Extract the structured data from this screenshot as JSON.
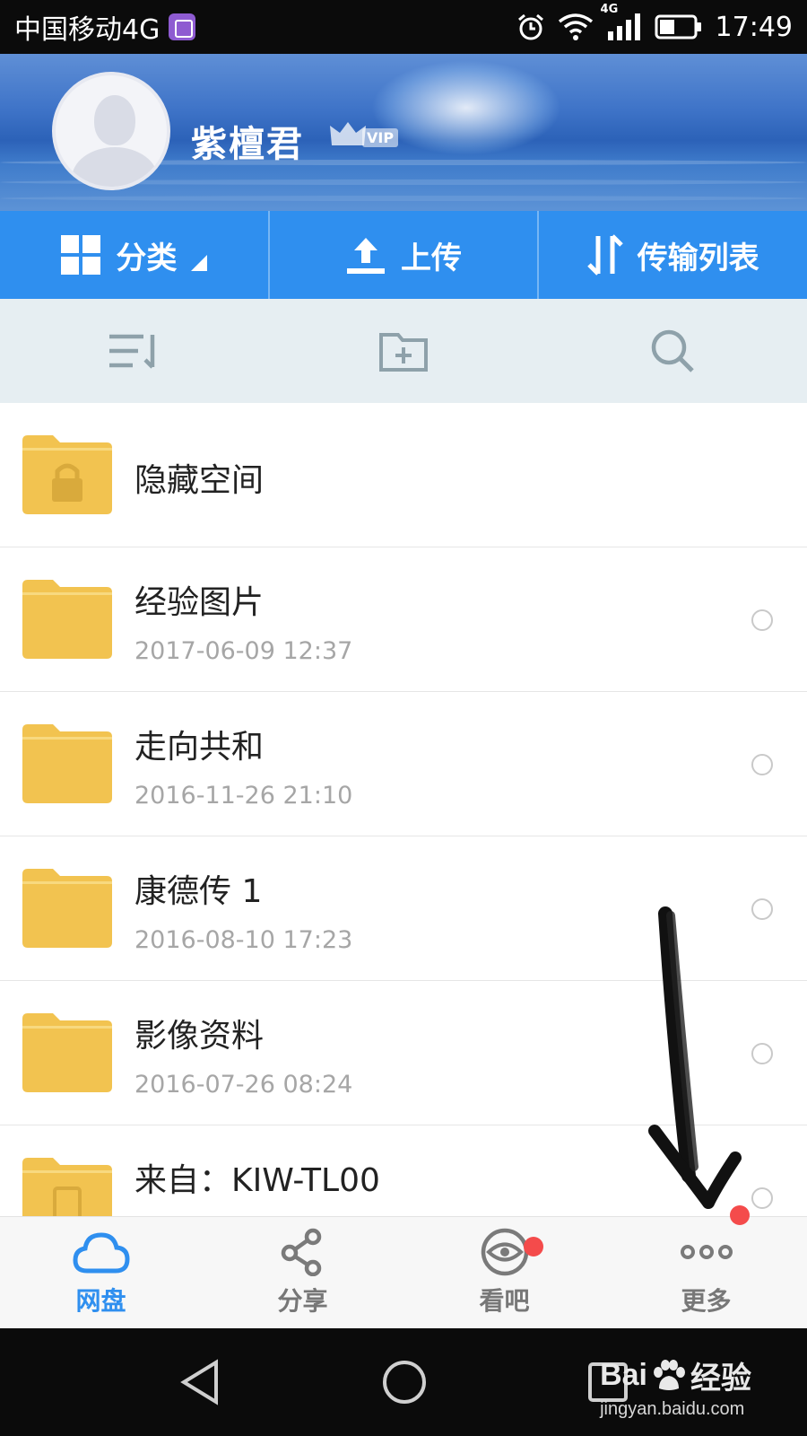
{
  "status_bar": {
    "carrier": "中国移动4G",
    "network": "4G",
    "time": "17:49"
  },
  "profile": {
    "username": "紫檀君",
    "badge": "VIP"
  },
  "actions": [
    {
      "label": "分类",
      "icon": "grid-icon"
    },
    {
      "label": "上传",
      "icon": "upload-icon"
    },
    {
      "label": "传输列表",
      "icon": "transfer-icon"
    }
  ],
  "toolbar": {
    "icons": [
      "sort-icon",
      "new-folder-icon",
      "search-icon"
    ]
  },
  "files": [
    {
      "name": "隐藏空间",
      "date": "",
      "type": "locked-folder"
    },
    {
      "name": "经验图片",
      "date": "2017-06-09  12:37",
      "type": "folder"
    },
    {
      "name": "走向共和",
      "date": "2016-11-26  21:10",
      "type": "folder"
    },
    {
      "name": "康德传 1",
      "date": "2016-08-10  17:23",
      "type": "folder"
    },
    {
      "name": "影像资料",
      "date": "2016-07-26  08:24",
      "type": "folder"
    },
    {
      "name": "来自：KIW-TL00",
      "date": "",
      "type": "device-folder"
    }
  ],
  "bottom_nav": [
    {
      "label": "网盘",
      "icon": "cloud-icon",
      "active": true,
      "badge": false
    },
    {
      "label": "分享",
      "icon": "share-icon",
      "active": false,
      "badge": false
    },
    {
      "label": "看吧",
      "icon": "eye-icon",
      "active": false,
      "badge": true
    },
    {
      "label": "更多",
      "icon": "more-icon",
      "active": false,
      "badge": true
    }
  ],
  "watermark": {
    "brand": "Bai",
    "brand_suffix": "经验",
    "url": "jingyan.baidu.com"
  },
  "colors": {
    "accent": "#2f8fef",
    "folder": "#f2c350",
    "badge": "#f44b4b"
  }
}
